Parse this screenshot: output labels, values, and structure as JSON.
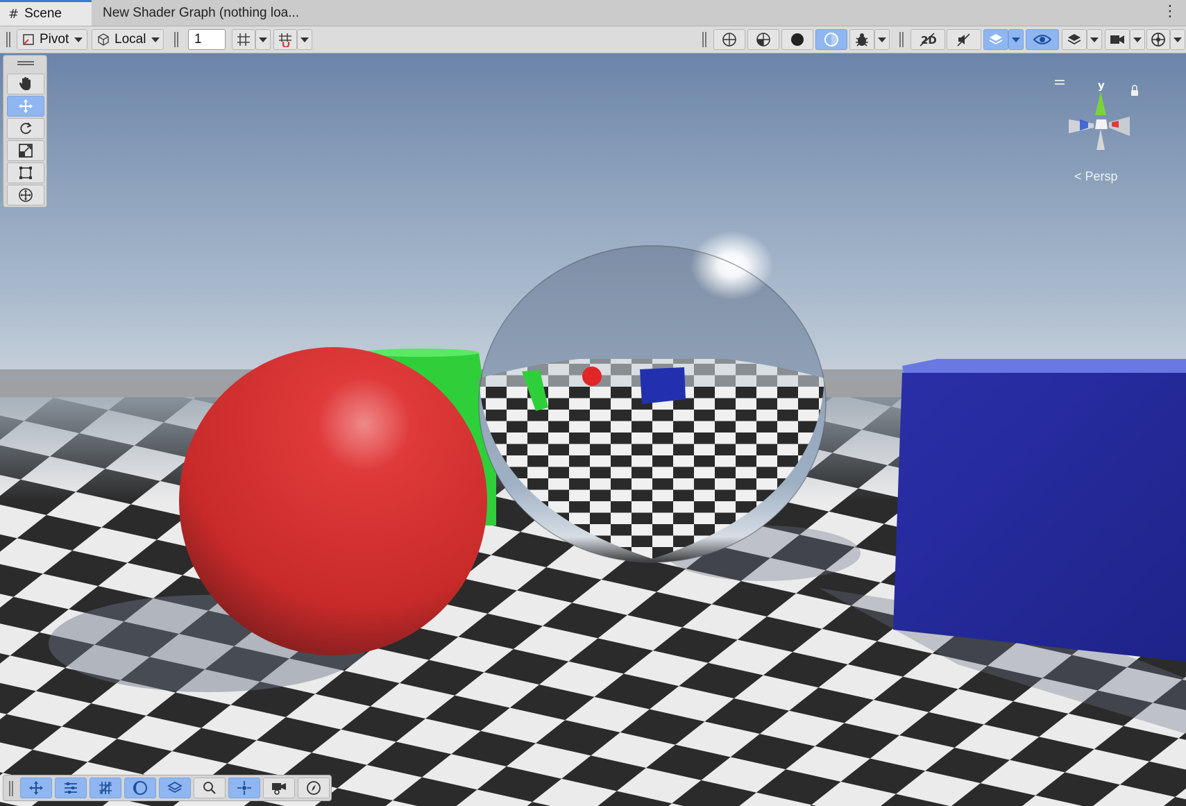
{
  "tabs": [
    {
      "label": "Scene",
      "icon": "hash-icon",
      "active": true
    },
    {
      "label": "New Shader Graph (nothing loa...",
      "active": false
    }
  ],
  "toolbar": {
    "pivot_label": "Pivot",
    "space_label": "Local",
    "increment_value": "1"
  },
  "gizmo": {
    "y_label": "y",
    "projection_label": "Persp"
  },
  "colors": {
    "accent": "#3a79d6",
    "active_button": "#8fb6f0",
    "sky_top": "#6b84a8",
    "sky_horizon": "#c3d0dd",
    "red_sphere": "#d42a2a",
    "green_cylinder": "#2fcf3a",
    "blue_cube": "#24289a"
  },
  "tools": [
    "hand-icon",
    "move-icon",
    "rotate-icon",
    "scale-icon",
    "rect-icon",
    "transform-icon"
  ],
  "overlay_tools": [
    "move-icon",
    "sliders-icon",
    "grid-icon",
    "shading-icon",
    "layers-icon",
    "search-icon",
    "pivot-icon",
    "camera-icon",
    "compass-icon"
  ]
}
